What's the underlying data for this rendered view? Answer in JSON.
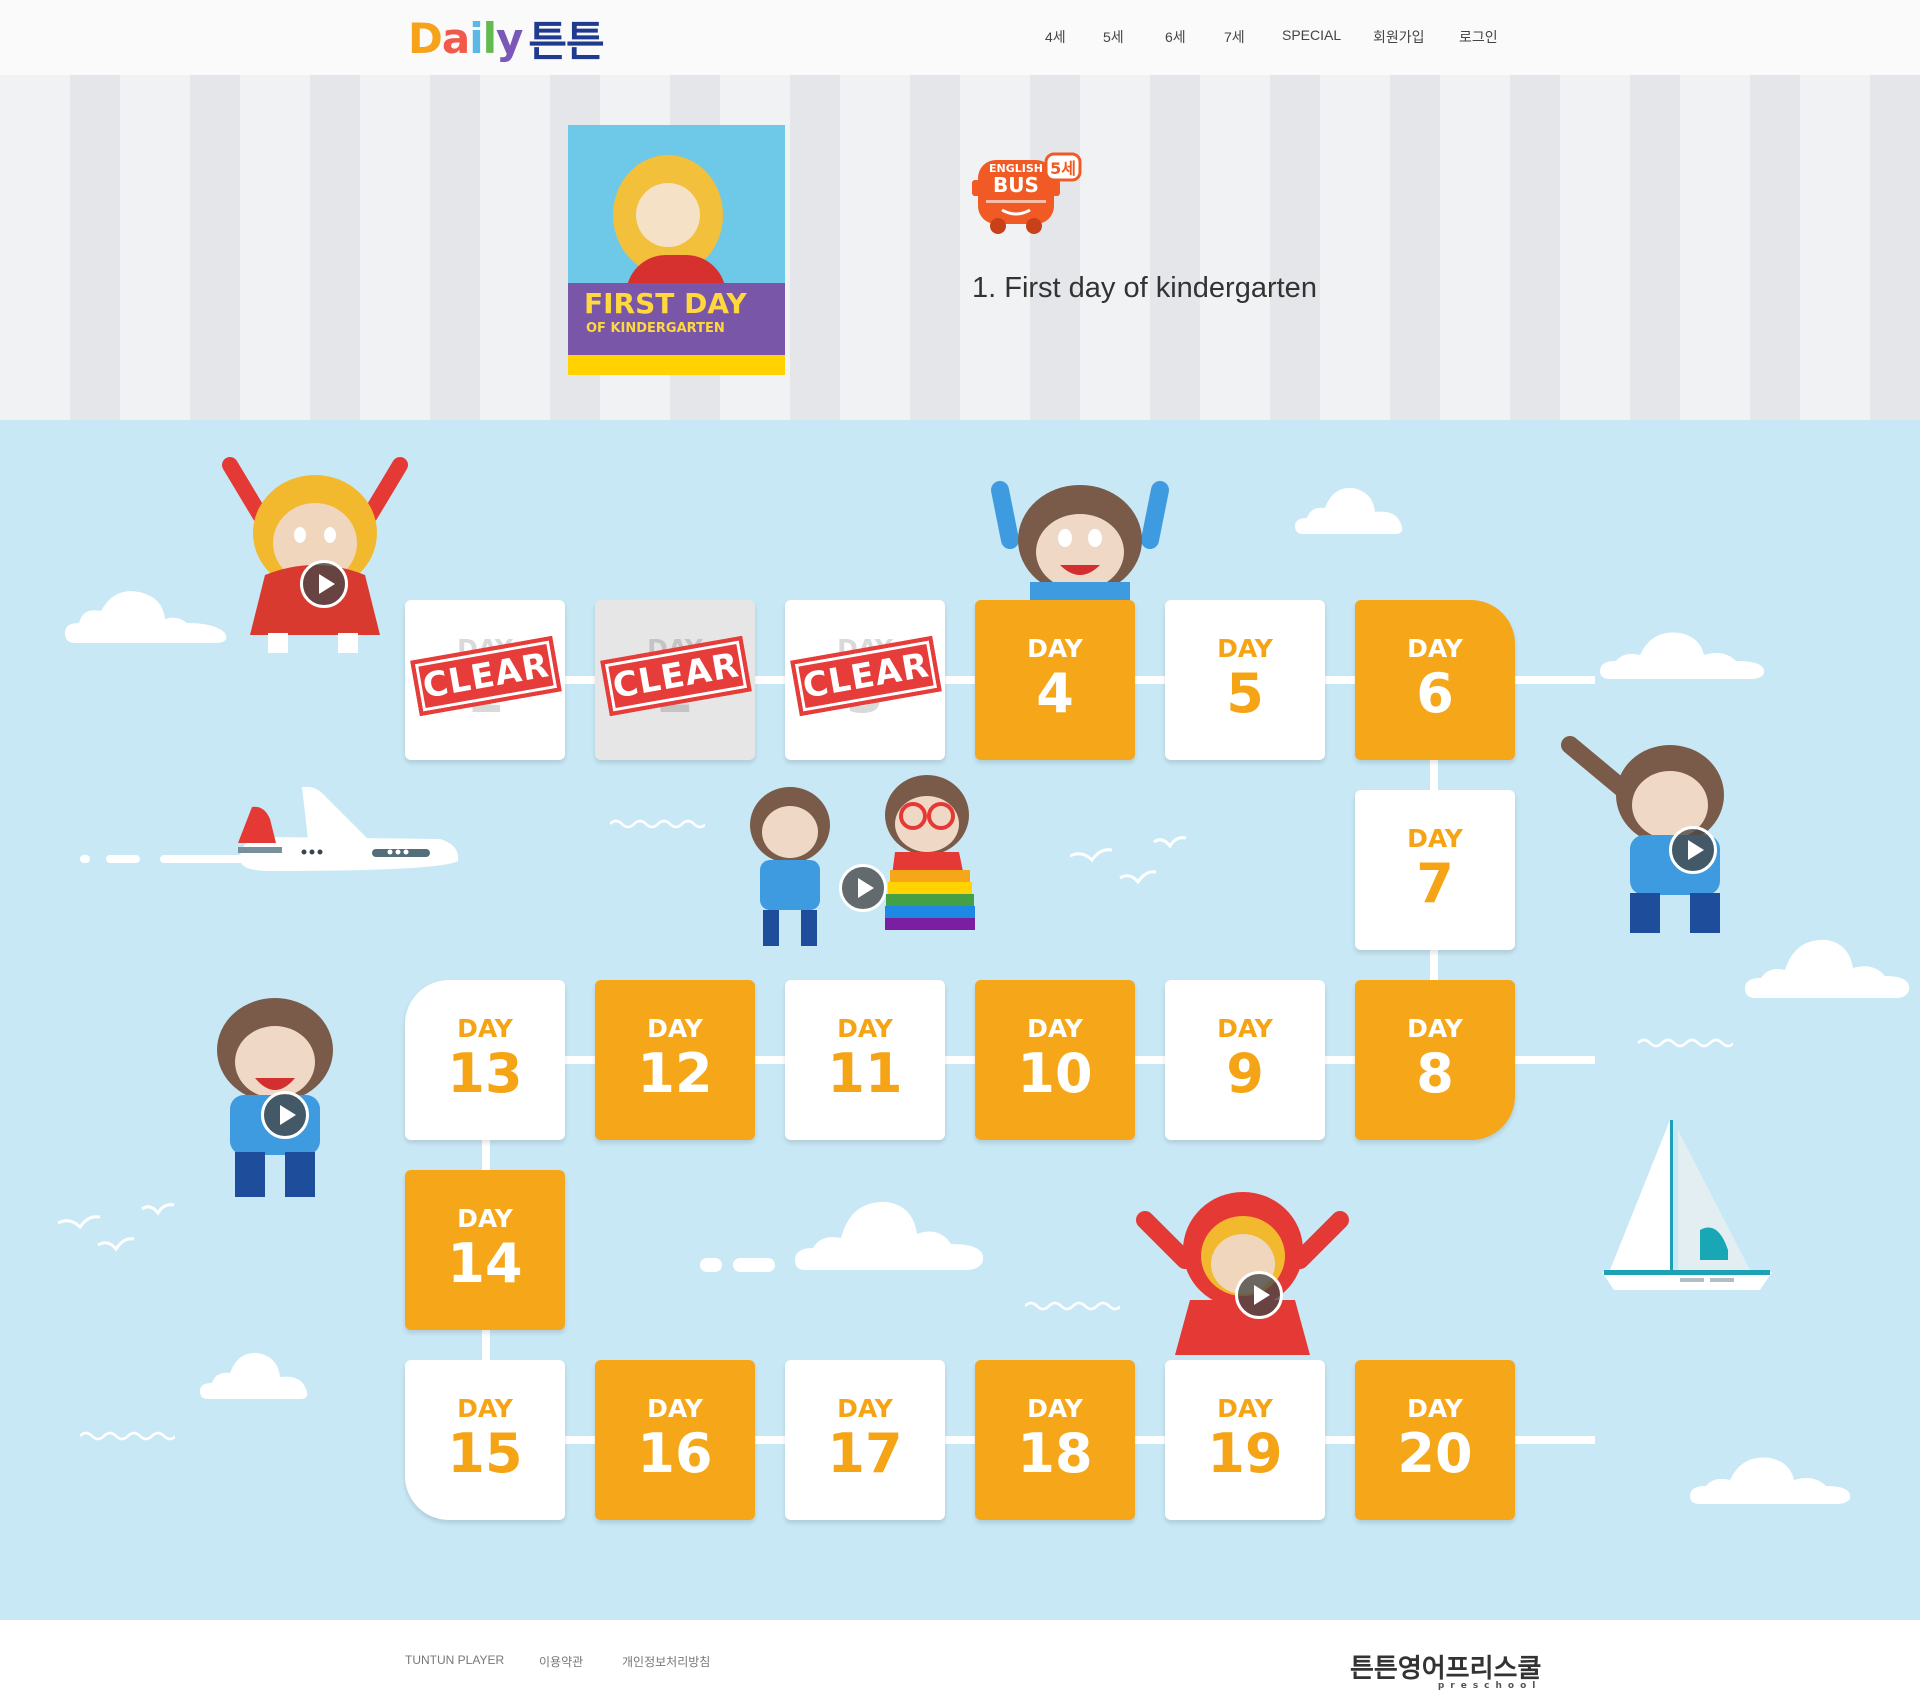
{
  "header": {
    "logo": {
      "d": "D",
      "a": "a",
      "i": "i",
      "l": "l",
      "y": "y",
      "tt": "튼튼"
    },
    "nav": [
      "4세",
      "5세",
      "6세",
      "7세",
      "SPECIAL",
      "회원가입",
      "로그인"
    ]
  },
  "book": {
    "cover_title_1": "FIRST DAY",
    "cover_title_2": "OF KINDERGARTEN",
    "bus_badge": "5세",
    "bus_label_1": "ENGLISH",
    "bus_label_2": "BUS",
    "title": "1. First day of kindergarten"
  },
  "board": {
    "day_label": "DAY",
    "clear_label": "CLEAR",
    "days": [
      {
        "n": "1",
        "state": "clear"
      },
      {
        "n": "2",
        "state": "clear"
      },
      {
        "n": "3",
        "state": "clear"
      },
      {
        "n": "4",
        "state": "open"
      },
      {
        "n": "5",
        "state": "open"
      },
      {
        "n": "6",
        "state": "open"
      },
      {
        "n": "7",
        "state": "open"
      },
      {
        "n": "8",
        "state": "open"
      },
      {
        "n": "9",
        "state": "open"
      },
      {
        "n": "10",
        "state": "open"
      },
      {
        "n": "11",
        "state": "open"
      },
      {
        "n": "12",
        "state": "open"
      },
      {
        "n": "13",
        "state": "open"
      },
      {
        "n": "14",
        "state": "open"
      },
      {
        "n": "15",
        "state": "open"
      },
      {
        "n": "16",
        "state": "open"
      },
      {
        "n": "17",
        "state": "open"
      },
      {
        "n": "18",
        "state": "open"
      },
      {
        "n": "19",
        "state": "open"
      },
      {
        "n": "20",
        "state": "open"
      }
    ]
  },
  "footer": {
    "links": [
      "TUNTUN PLAYER",
      "이용약관",
      "개인정보처리방침"
    ],
    "brand": "튼튼영어프리스쿨",
    "brand_sub": "preschool"
  },
  "colors": {
    "orange": "#f6a619",
    "sky": "#c8e8f5",
    "stamp_red": "#e63d3a",
    "navy": "#1f3a8f"
  },
  "icons": [
    "play-icon",
    "bus-icon",
    "cloud-icon",
    "airplane-icon",
    "sailboat-icon",
    "monkey-character"
  ]
}
